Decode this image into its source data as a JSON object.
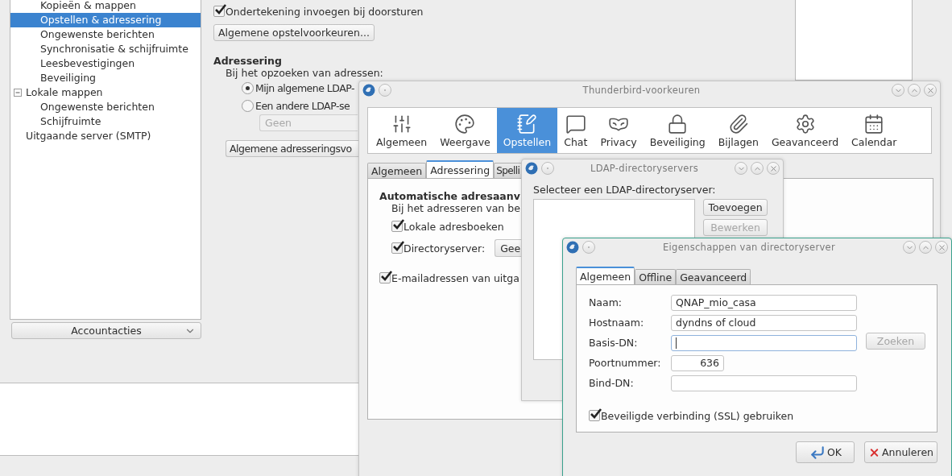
{
  "tree": [
    {
      "children": [
        {
          "label": "Kopieën & mappen",
          "selected": false
        },
        {
          "label": "Opstellen & adressering",
          "selected": true
        },
        {
          "label": "Ongewenste berichten",
          "selected": false
        },
        {
          "label": "Synchronisatie & schijfruimte",
          "selected": false
        },
        {
          "label": "Leesbevestigingen",
          "selected": false
        },
        {
          "label": "Beveiliging",
          "selected": false
        }
      ]
    },
    {
      "label": "Lokale mappen",
      "selected": false,
      "expanded": true,
      "children": [
        {
          "label": "Ongewenste berichten",
          "selected": false
        },
        {
          "label": "Schijfruimte",
          "selected": false
        }
      ]
    },
    {
      "label": "Uitgaande server (SMTP)",
      "selected": false
    }
  ],
  "account_actions": {
    "label": "Accountacties"
  },
  "composition": {
    "signature_checkbox": {
      "label": "Ondertekening invoegen bij doorsturen",
      "checked": true
    },
    "prefs_button": "Algemene opstelvoorkeuren...",
    "addressing_heading": "Adressering",
    "lookup_label": "Bij het opzoeken van adressen:",
    "radios": [
      {
        "label": "Mijn algemene LDAP-",
        "selected": true
      },
      {
        "label": "Een andere LDAP-se",
        "selected": false
      }
    ],
    "server_select": {
      "value": "Geen",
      "disabled": true
    },
    "addressing_button": "Algemene adresseringsvo"
  },
  "preferences_window": {
    "title": "Thunderbird-voorkeuren",
    "panes": [
      {
        "label": "Algemeen",
        "selected": false
      },
      {
        "label": "Weergave",
        "selected": false
      },
      {
        "label": "Opstellen",
        "selected": true
      },
      {
        "label": "Chat",
        "selected": false
      },
      {
        "label": "Privacy",
        "selected": false
      },
      {
        "label": "Beveiliging",
        "selected": false
      },
      {
        "label": "Bijlagen",
        "selected": false
      },
      {
        "label": "Geavanceerd",
        "selected": false
      },
      {
        "label": "Calendar",
        "selected": false
      }
    ],
    "tabs": [
      {
        "label": "Algemeen",
        "selected": false
      },
      {
        "label": "Adressering",
        "selected": true
      },
      {
        "label": "Spelli",
        "selected": false
      }
    ],
    "autocomplete_heading": "Automatische adresaanv",
    "autocomplete_label": "Bij het adresseren van be",
    "checkboxes": [
      {
        "label": "Lokale adresboeken",
        "checked": true
      },
      {
        "label": "Directoryserver:",
        "checked": true
      }
    ],
    "directory_select": "Gee",
    "outgoing_checkbox": {
      "label": "E-mailadressen van uitga",
      "checked": true
    }
  },
  "ldap_window": {
    "title": "LDAP-directoryservers",
    "list_label": "Selecteer een LDAP-directoryserver:",
    "buttons": [
      {
        "label": "Toevoegen",
        "disabled": false
      },
      {
        "label": "Bewerken",
        "disabled": true
      }
    ]
  },
  "properties_window": {
    "title": "Eigenschappen van directoryserver",
    "tabs": [
      {
        "label": "Algemeen",
        "selected": true
      },
      {
        "label": "Offline",
        "selected": false
      },
      {
        "label": "Geavanceerd",
        "selected": false
      }
    ],
    "fields": [
      {
        "label": "Naam:",
        "kind": "text",
        "value": "QNAP_mio_casa",
        "focused": false
      },
      {
        "label": "Hostnaam:",
        "kind": "text",
        "value": "dyndns of cloud",
        "focused": false
      },
      {
        "label": "Basis-DN:",
        "kind": "text",
        "focused": true,
        "button": {
          "label": "Zoeken",
          "disabled": true
        }
      },
      {
        "label": "Poortnummer:",
        "kind": "number",
        "value": "636",
        "focused": false
      },
      {
        "label": "Bind-DN:",
        "kind": "text",
        "focused": false
      }
    ],
    "ssl_checkbox": {
      "label": "Beveiligde verbinding (SSL) gebruiken",
      "checked": true
    },
    "buttons": [
      {
        "label": "OK",
        "kind": "ok"
      },
      {
        "label": "Annuleren",
        "kind": "cancel"
      }
    ]
  }
}
